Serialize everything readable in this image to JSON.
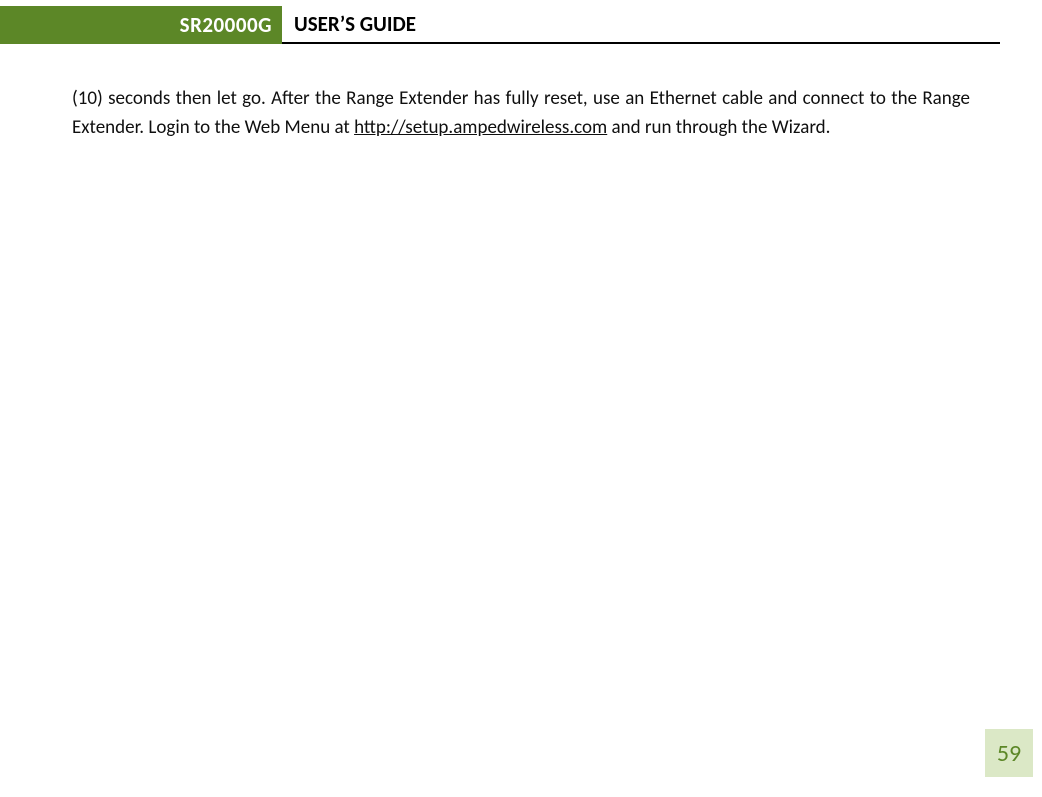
{
  "header": {
    "model": "SR20000G",
    "title": "USER’S GUIDE"
  },
  "body": {
    "text_before_link": "(10) seconds then let go. After the Range Extender has fully reset, use an Ethernet cable and connect to the Range Extender. Login to the Web Menu at ",
    "link_text": "http://setup.ampedwireless.com",
    "link_href": "http://setup.ampedwireless.com",
    "text_after_link": " and run through the Wizard."
  },
  "page_number": "59"
}
